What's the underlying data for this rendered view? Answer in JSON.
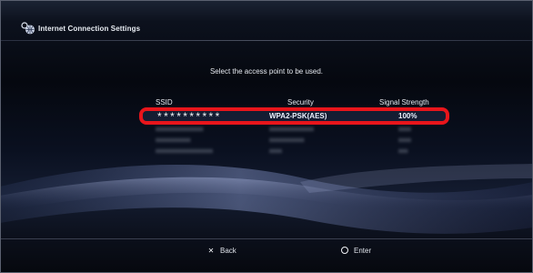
{
  "header": {
    "title": "Internet Connection Settings",
    "icon": "network-globe-icon"
  },
  "prompt": "Select the access point to be used.",
  "columns": {
    "ssid": "SSID",
    "security": "Security",
    "signal": "Signal Strength"
  },
  "access_points": [
    {
      "ssid": "**********",
      "security": "WPA2-PSK(AES)",
      "signal": "100%",
      "selected": true
    },
    {
      "ssid": "xxxxxxxxxxxxxxx",
      "security": "xxxxxxxxxxxxxx",
      "signal": "xxxx",
      "selected": false
    },
    {
      "ssid": "xxxxxxxxxxx",
      "security": "xxxxxxxxxxx",
      "signal": "xxxx",
      "selected": false
    },
    {
      "ssid": "xxxxxxxxxxxxxxxxxx",
      "security": "xxxx",
      "signal": "xxx",
      "selected": false
    }
  ],
  "footer": {
    "back_label": "Back",
    "enter_label": "Enter",
    "back_icon": "cross-button-icon",
    "enter_icon": "circle-button-icon"
  },
  "colors": {
    "selection_border": "#e8151b",
    "text": "#e6e9ef",
    "background": "#05080f"
  }
}
